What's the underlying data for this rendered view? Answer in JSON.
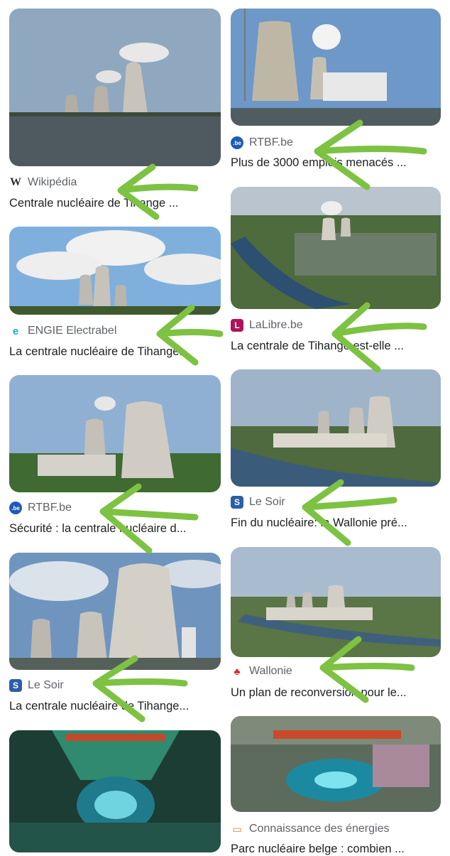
{
  "results": [
    {
      "source": "Wikipédia",
      "title": "Centrale nucléaire de Tihange ...",
      "icon": "wikipedia-icon",
      "fav_text": "W",
      "fav_color": "#ffffff",
      "fav_fg": "#333333"
    },
    {
      "source": "RTBF.be",
      "title": "Plus de 3000 emplois menacés ...",
      "icon": "rtbf-icon",
      "fav_text": ".be",
      "fav_color": "#1e5bb8",
      "fav_fg": "#ffffff"
    },
    {
      "source": "ENGIE Electrabel",
      "title": "La centrale nucléaire de Tihange...",
      "icon": "engie-icon",
      "fav_text": "e",
      "fav_color": "#ffffff",
      "fav_fg": "#1aa7e0"
    },
    {
      "source": "LaLibre.be",
      "title": "La centrale de Tihange est-elle ...",
      "icon": "lalibre-icon",
      "fav_text": "L",
      "fav_color": "#b0135c",
      "fav_fg": "#ffffff"
    },
    {
      "source": "RTBF.be",
      "title": "Sécurité : la centrale nucléaire d...",
      "icon": "rtbf-icon",
      "fav_text": ".be",
      "fav_color": "#1e5bb8",
      "fav_fg": "#ffffff"
    },
    {
      "source": "Le Soir",
      "title": "Fin du nucléaire: la Wallonie pré...",
      "icon": "lesoir-icon",
      "fav_text": "S",
      "fav_color": "#2a5fa8",
      "fav_fg": "#ffffff"
    },
    {
      "source": "Le Soir",
      "title": "La centrale nucléaire de Tihange...",
      "icon": "lesoir-icon",
      "fav_text": "S",
      "fav_color": "#2a5fa8",
      "fav_fg": "#ffffff"
    },
    {
      "source": "Wallonie",
      "title": "Un plan de reconversion pour le...",
      "icon": "wallonie-rooster-icon",
      "fav_text": "🐓",
      "fav_color": "#ffffff",
      "fav_fg": "#d22a2a"
    },
    {
      "source": "",
      "title": "",
      "icon": "",
      "fav_text": "",
      "fav_color": "#ffffff",
      "fav_fg": "#ffffff"
    },
    {
      "source": "Connaissance des énergies",
      "title": "Parc nucléaire belge : combien ...",
      "icon": "connaissance-energies-icon",
      "fav_text": "▭",
      "fav_color": "#ffffff",
      "fav_fg": "#e07a3a"
    }
  ],
  "colors": {
    "arrow": "#7dc242",
    "source_text": "#5f6368",
    "title_text": "#202124"
  }
}
